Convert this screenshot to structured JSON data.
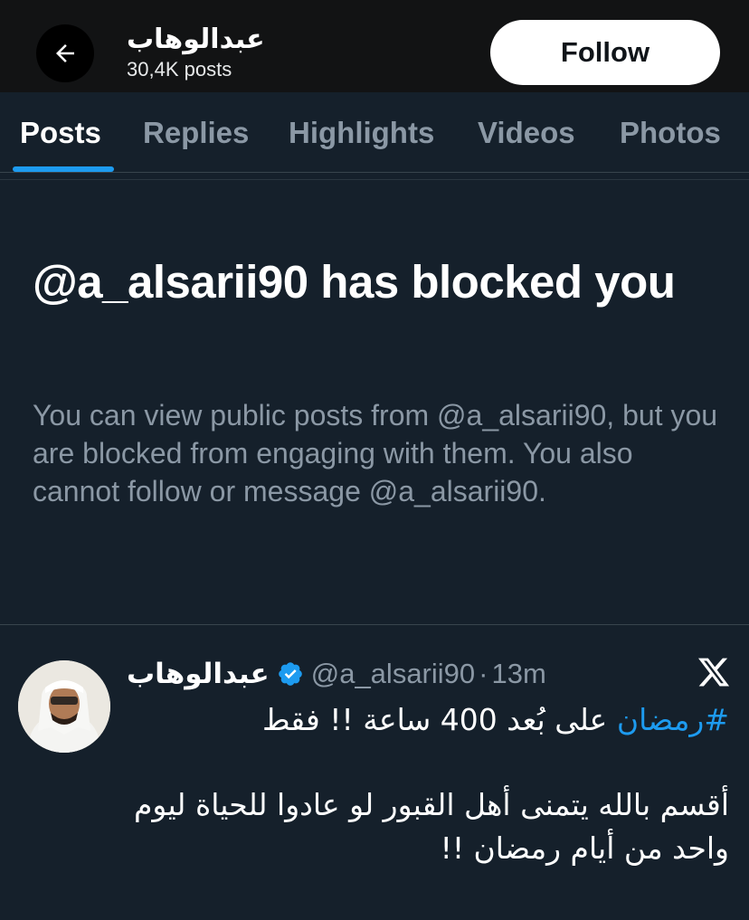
{
  "header": {
    "name": "عبدالوهاب",
    "post_count": "30,4K posts",
    "follow_label": "Follow",
    "back_icon": "arrow-left-icon"
  },
  "tabs": [
    {
      "label": "Posts",
      "active": true
    },
    {
      "label": "Replies",
      "active": false
    },
    {
      "label": "Highlights",
      "active": false
    },
    {
      "label": "Videos",
      "active": false
    },
    {
      "label": "Photos",
      "active": false
    }
  ],
  "blocked": {
    "title": "@a_alsarii90 has blocked you",
    "description": "You can view public posts from @a_alsarii90, but you are blocked from engaging with them. You also cannot follow or message @a_alsarii90."
  },
  "tweet": {
    "name": "عبدالوهاب",
    "handle": "@a_alsarii90",
    "separator": "·",
    "time": "13m",
    "verified_icon": "verified-badge-icon",
    "source_icon": "x-logo-icon",
    "line1_hashtag": "#رمضان",
    "line1_text": " على بُعد 400 ساعة !! فقط",
    "line2": "أقسم بالله يتمنى أهل القبور لو عادوا للحياة ليوم",
    "line3": "واحد من أيام رمضان !!"
  },
  "colors": {
    "background": "#15202b",
    "topbar": "#121314",
    "accent": "#1d9bf0",
    "muted_text": "#8b98a5",
    "divider": "#38444d"
  }
}
